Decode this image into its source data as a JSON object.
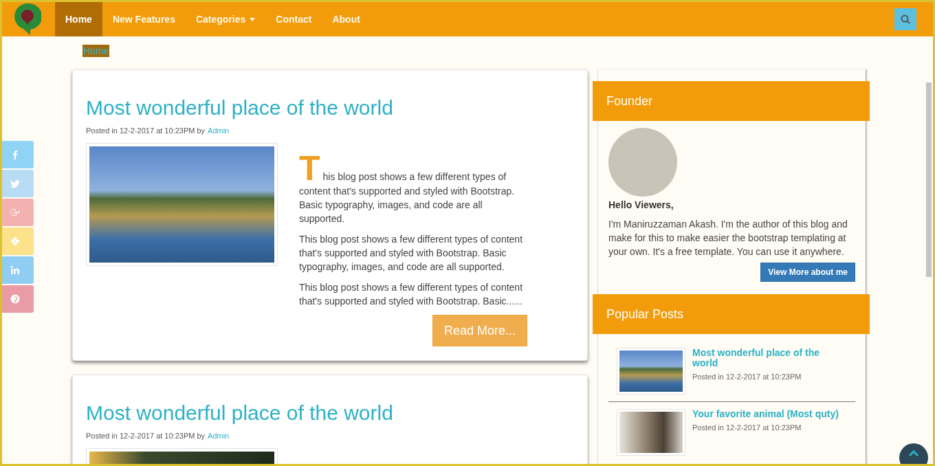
{
  "navbar": {
    "items": [
      {
        "label": "Home",
        "selected": true,
        "kind": "link"
      },
      {
        "label": "New Features",
        "selected": false,
        "kind": "link"
      },
      {
        "label": "Categories",
        "selected": false,
        "kind": "dropdown"
      },
      {
        "label": "Contact",
        "selected": false,
        "kind": "link"
      },
      {
        "label": "About",
        "selected": false,
        "kind": "link"
      }
    ]
  },
  "breadcrumb": [
    "Home"
  ],
  "social_buttons": [
    {
      "kind": "facebook",
      "color": "#8fd4f6"
    },
    {
      "kind": "twitter",
      "color": "#b8dcf3"
    },
    {
      "kind": "googleplus",
      "color": "#f3b2b0"
    },
    {
      "kind": "flower",
      "color": "#fde28c"
    },
    {
      "kind": "linkedin",
      "color": "#8fcdf3"
    },
    {
      "kind": "pinterest",
      "color": "#e99ba6"
    }
  ],
  "posts": [
    {
      "title": "Most wonderful place of the world",
      "meta": "Posted in 12-2-2017 at 10:23PM by",
      "author": "Admin",
      "drop_cap": "T",
      "paragraphs": [
        "his blog post shows a few different types of content that's supported and styled with Bootstrap. Basic typography, images, and code are all supported.",
        "This blog post shows a few different types of content that's supported and styled with Bootstrap. Basic typography, images, and code are all supported.",
        "This blog post shows a few different types of content that's supported and styled with Bootstrap. Basic......"
      ],
      "button": "Read More..."
    },
    {
      "title": "Most wonderful place of the world",
      "meta": "Posted in 12-2-2017 at 10:23PM by",
      "author": "Admin"
    }
  ],
  "sidebar": {
    "founder": {
      "heading": "Founder",
      "greeting": "Hello Viewers,",
      "text": "I'm Maniruzzaman Akash. I'm the author of this blog and make for this to make easier the bootstrap templating at your own. It's a free template. You can use it anywhere.",
      "button": "View More about me"
    },
    "popular": {
      "heading": "Popular Posts",
      "items": [
        {
          "title": "Most wonderful place of the world",
          "date": "Posted in 12-2-2017 at 10:23PM"
        },
        {
          "title": "Your favorite animal (Most quty)",
          "date": "Posted in 12-2-2017 at 10:23PM"
        }
      ]
    }
  }
}
